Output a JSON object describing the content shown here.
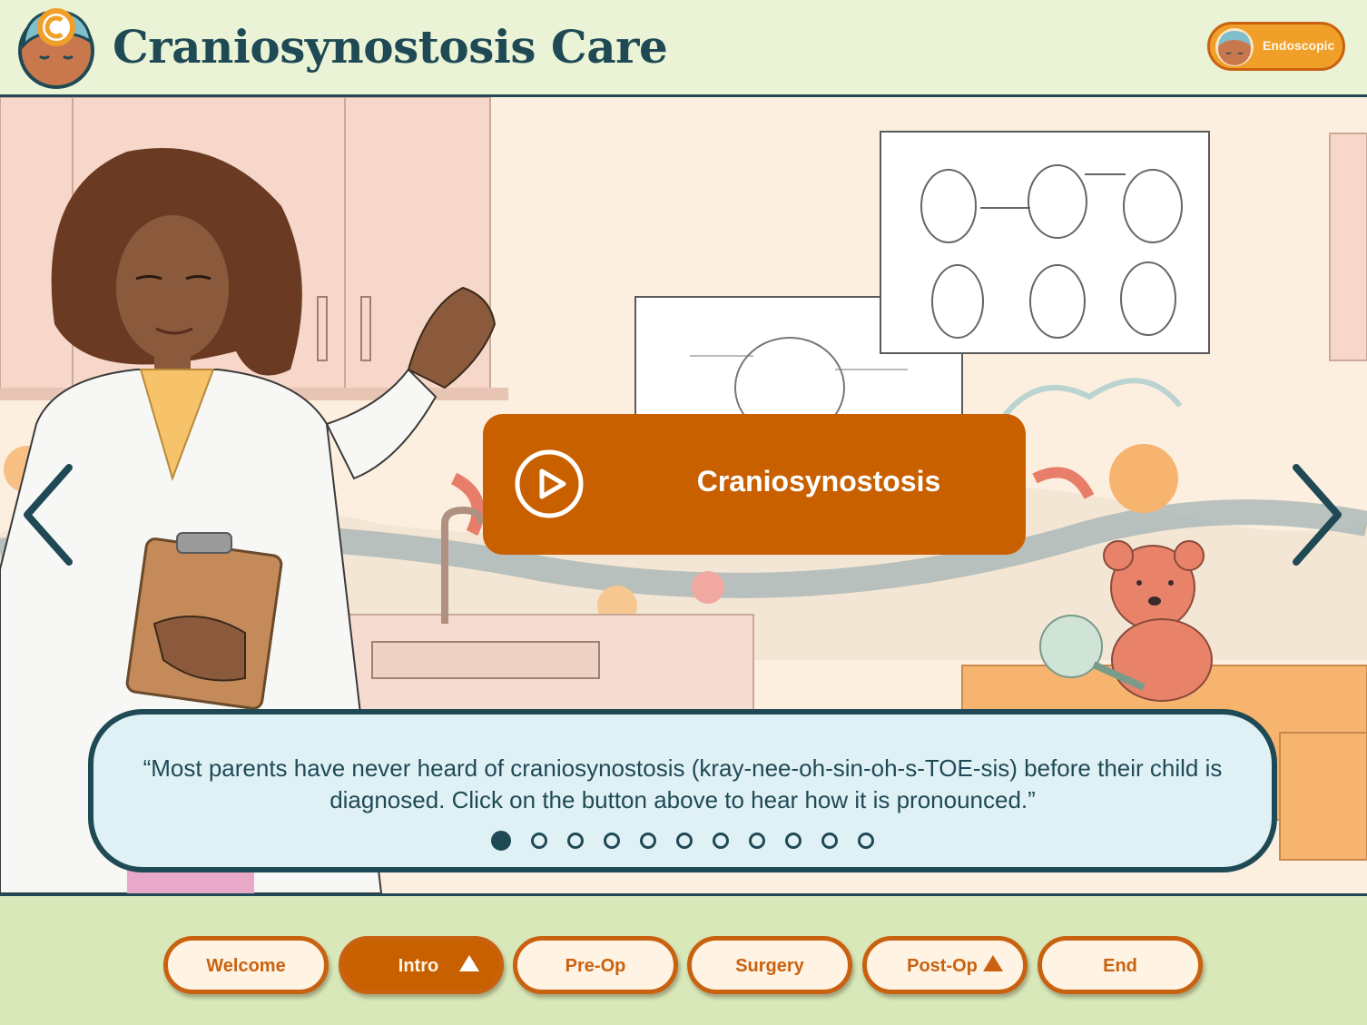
{
  "header": {
    "title": "Craniosynostosis Care",
    "mode_toggle_label": "Endoscopic"
  },
  "audio": {
    "label": "Craniosynostosis"
  },
  "speech": {
    "text": "“Most parents have never heard of craniosynostosis (kray-nee-oh-sin-oh-s-TOE-sis) before their child is diagnosed. Click on the button above to hear how it is pronounced.”"
  },
  "pagination": {
    "total": 11,
    "current": 1
  },
  "bottom_nav": {
    "items": [
      {
        "label": "Welcome",
        "active": false,
        "caret": false
      },
      {
        "label": "Intro",
        "active": true,
        "caret": true
      },
      {
        "label": "Pre-Op",
        "active": false,
        "caret": false
      },
      {
        "label": "Surgery",
        "active": false,
        "caret": false
      },
      {
        "label": "Post-Op",
        "active": false,
        "caret": true
      },
      {
        "label": "End",
        "active": false,
        "caret": false
      }
    ]
  },
  "colors": {
    "dark_teal": "#1f4a55",
    "orange": "#c96000",
    "accent_orange": "#f0a028",
    "cream": "#fff3e3",
    "header_bg": "#eaf3d6",
    "footer_bg": "#d8e8b8"
  },
  "icons": {
    "logo": "baby-head-logo-icon",
    "prev": "chevron-left-icon",
    "next": "chevron-right-icon",
    "play": "play-circle-icon",
    "caret": "caret-up-icon"
  }
}
